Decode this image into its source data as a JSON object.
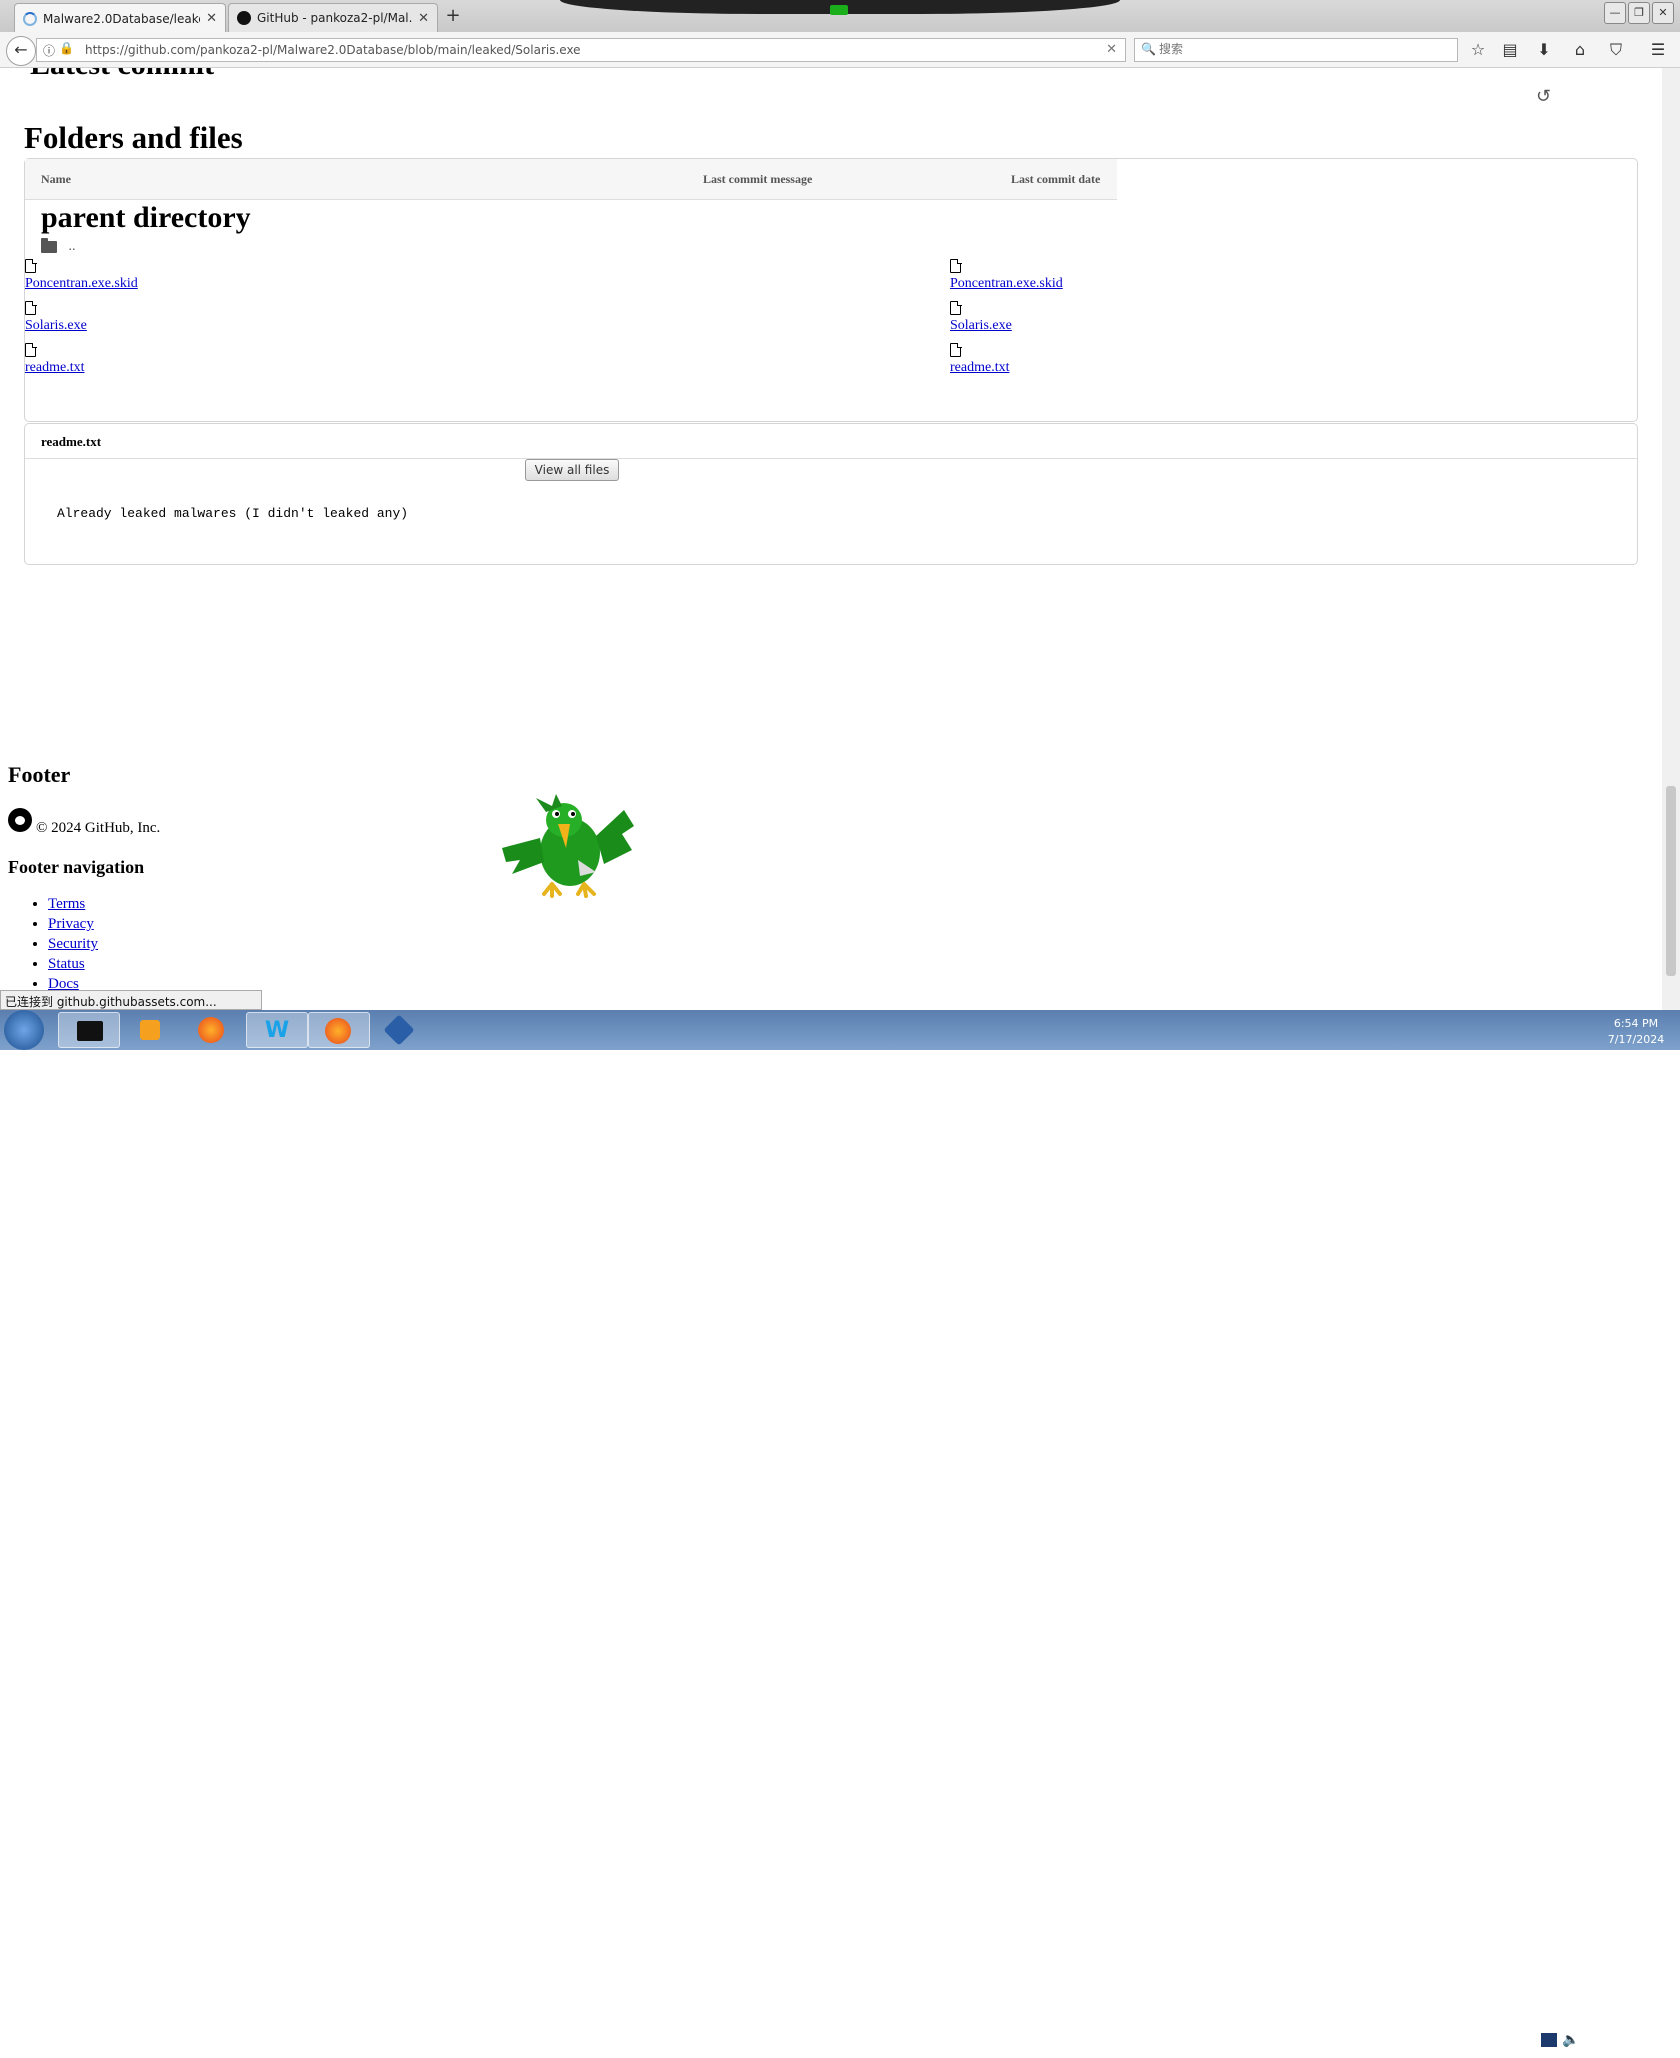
{
  "browser": {
    "tabs": [
      {
        "title": "Malware2.0Database/leake...",
        "active": true
      },
      {
        "title": "GitHub - pankoza2-pl/Mal...",
        "active": false
      }
    ],
    "url": "https://github.com/pankoza2-pl/Malware2.0Database/blob/main/leaked/Solaris.exe",
    "search_placeholder": "搜索"
  },
  "page": {
    "latest_commit_heading": "Latest commit",
    "folders_heading": "Folders and files",
    "table_headers": {
      "name": "Name",
      "message": "Last commit message",
      "date": "Last commit date"
    },
    "parent_directory": "parent directory",
    "parent_dots": "..",
    "files_left": [
      "Poncentran.exe.skid",
      "Solaris.exe",
      "readme.txt"
    ],
    "files_right": [
      "Poncentran.exe.skid",
      "Solaris.exe",
      "readme.txt"
    ],
    "view_all_files": "View all files",
    "readme_title": "readme.txt",
    "readme_body": "Already leaked malwares (I didn't leaked any)",
    "footer_heading": "Footer",
    "copyright": "© 2024 GitHub, Inc.",
    "footer_nav_heading": "Footer navigation",
    "footer_links": [
      "Terms",
      "Privacy",
      "Security",
      "Status",
      "Docs"
    ]
  },
  "status_bar": "已连接到 github.githubassets.com...",
  "taskbar": {
    "time": "6:54 PM",
    "date": "7/17/2024"
  }
}
